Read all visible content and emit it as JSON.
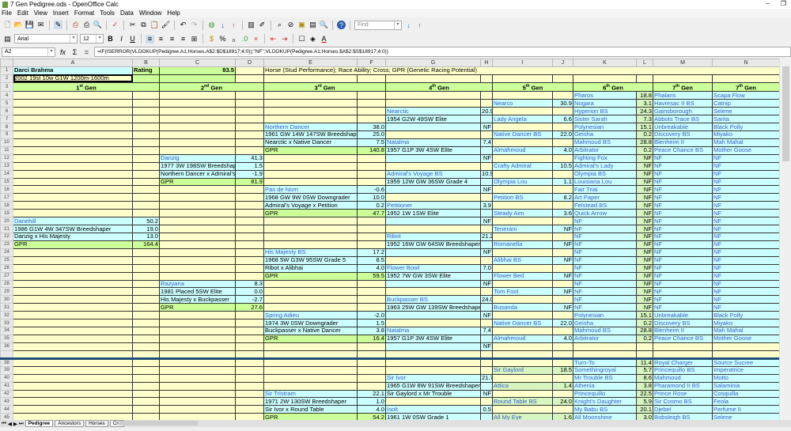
{
  "window": {
    "title": "7 Gen Pedigree.ods - OpenOffice Calc",
    "min": "–",
    "restore": "❐"
  },
  "menu": [
    "File",
    "Edit",
    "View",
    "Insert",
    "Format",
    "Tools",
    "Data",
    "Window",
    "Help"
  ],
  "toolbar": {
    "find_placeholder": "Find",
    "font_name": "Arial",
    "font_size": "12"
  },
  "formula_bar": {
    "cell_ref": "A2",
    "fx": "fx",
    "sum": "Σ",
    "eq": "=",
    "formula": "=IF(ISERROR(VLOOKUP(Pedigree.A1;Horses.A$2:$D$18917;4;0));\"NF\";VLOOKUP(Pedigree.A1;Horses.$A$2:$S$18917;4;0))"
  },
  "columns": [
    "A",
    "B",
    "C",
    "D",
    "E",
    "F",
    "G",
    "H",
    "I",
    "J",
    "K",
    "L",
    "M",
    "N"
  ],
  "header_rows": {
    "r1": {
      "A": "Darci Brahma",
      "B": "Rating",
      "C": "83.5",
      "E": "Horse (Stud Performance); Race Ability; Cross; GPR (Genetic Racing Potential)"
    },
    "r2": {
      "A": "2002 19st 10w G1W 1200m-1600m"
    },
    "gens": [
      {
        "n": "1",
        "sup": "st",
        "label": " Gen"
      },
      {
        "n": "2",
        "sup": "nd",
        "label": " Gen"
      },
      {
        "n": "3",
        "sup": "rd",
        "label": " Gen"
      },
      {
        "n": "4",
        "sup": "th",
        "label": " Gen"
      },
      {
        "n": "5",
        "sup": "th",
        "label": " Gen"
      },
      {
        "n": "6",
        "sup": "th",
        "label": " Gen"
      },
      {
        "n": "7",
        "sup": "th",
        "label": " Gen"
      },
      {
        "n": "7",
        "sup": "th",
        "label": " Gen"
      }
    ]
  },
  "rows": [
    {
      "n": 4,
      "K": "Pharos",
      "L": "18.8",
      "M": "Phalaris",
      "N": "Scapa Flow"
    },
    {
      "n": 5,
      "I": "Nearco",
      "J": "30.9",
      "K": "Nogara",
      "L": "3.1",
      "M": "Havresac II BS",
      "N": "Catnip"
    },
    {
      "n": 6,
      "G": "Nearctic",
      "H": "20.9",
      "K": "Hyperion BS",
      "L": "24.3",
      "M": "Gainsborough",
      "N": "Selene"
    },
    {
      "n": 7,
      "G": "1954 G2W 49SW Elite",
      "I": "Lady Angela",
      "J": "6.6",
      "K": "Sister Sarah",
      "L": "7.3",
      "M": "Abbots Trace BS",
      "N": "Sarita"
    },
    {
      "n": 8,
      "E": "Northern Dancer",
      "F": "38.0",
      "H": "NF",
      "K": "Polynesian",
      "L": "15.1",
      "M": "Unbreakable",
      "N": "Black Polly"
    },
    {
      "n": 9,
      "E": "1961 GW 14W 147SW Breedshaper",
      "F": "25.0",
      "I": "Native Dancer BS",
      "J": "22.0",
      "K": "Geisha",
      "L": "0.2",
      "M": "Discovery BS",
      "N": "Miyako"
    },
    {
      "n": 10,
      "E": "Nearctic x Native Dancer",
      "F": "7.5",
      "G": "Natalma",
      "H": "7.4",
      "K": "Mahmoud BS",
      "L": "28.8",
      "M": "Blenheim II",
      "N": "Mah Mahal"
    },
    {
      "n": 11,
      "E": "GPR",
      "F": "140.8",
      "G": "1957 G1P 3W 4SW Elite",
      "I": "Almahmoud",
      "J": "4.0",
      "K": "Arbitrator",
      "L": "0.2",
      "M": "Peace Chance BS",
      "N": "Mother Goose"
    },
    {
      "n": 12,
      "C": "Danzig",
      "D": "41.3",
      "H": "NF",
      "K": "Fighting Fox",
      "L": "NF",
      "M": "NF",
      "N": "NF"
    },
    {
      "n": 13,
      "C": "1977 3W 198SW Breedshaper",
      "D": "1.5",
      "I": "Crafty Admiral",
      "J": "10.5",
      "K": "Admiral's Lady",
      "L": "NF",
      "M": "NF",
      "N": "NF"
    },
    {
      "n": 14,
      "C": "Northern Dancer x Admiral's Voyage",
      "D": "-1.9",
      "G": "Admiral's Voyage BS",
      "H": "10.9",
      "K": "Olympia BS",
      "L": "NF",
      "M": "NF",
      "N": "NF"
    },
    {
      "n": 15,
      "C": "GPR",
      "D": "81.9",
      "G": "1959 12W GW 36SW Grade 4",
      "I": "Olympia Lou",
      "J": "1.1",
      "K": "Louisiana Lou",
      "L": "NF",
      "M": "NF",
      "N": "NF"
    },
    {
      "n": 16,
      "E": "Pas de Nom",
      "F": "-0.6",
      "H": "NF",
      "K": "Fair Trial",
      "L": "NF",
      "M": "NF",
      "N": "NF"
    },
    {
      "n": 17,
      "E": "1968 GW 9W 0SW Downgrader",
      "F": "10.0",
      "I": "Petition BS",
      "J": "8.2",
      "K": "Art Paper",
      "L": "NF",
      "M": "NF",
      "N": "NF"
    },
    {
      "n": 18,
      "E": "Admiral's Voyage x Petition",
      "F": "0.2",
      "G": "Petitioner",
      "H": "3.9",
      "K": "Felstead BS",
      "L": "NF",
      "M": "NF",
      "N": "NF"
    },
    {
      "n": 19,
      "E": "GPR",
      "F": "47.7",
      "G": "1952 1W 1SW Elite",
      "I": "Steady Aim",
      "J": "3.6",
      "K": "Quick Arrow",
      "L": "NF",
      "M": "NF",
      "N": "NF"
    },
    {
      "n": 20,
      "A": "Danehill",
      "B": "50.2",
      "H": "NF",
      "K": "NF",
      "L": "NF",
      "M": "NF",
      "N": "NF"
    },
    {
      "n": 21,
      "A": "1986 G1W 4W 347SW Breedshaper",
      "B": "19.0",
      "I": "Tenerani",
      "J": "NF",
      "K": "NF",
      "L": "NF",
      "M": "NF",
      "N": "NF"
    },
    {
      "n": 22,
      "A": "Danzig x His Majesty",
      "B": "13.0",
      "G": "Ribot",
      "H": "21.2",
      "K": "NF",
      "L": "NF",
      "M": "NF",
      "N": "NF"
    },
    {
      "n": 23,
      "A": "GPR",
      "B": "164.4",
      "G": "1952 16W GW 64SW Breedshaper",
      "I": "Romanella",
      "J": "NF",
      "K": "NF",
      "L": "NF",
      "M": "NF",
      "N": "NF"
    },
    {
      "n": 24,
      "E": "His Majesty BS",
      "F": "17.2",
      "H": "NF",
      "K": "NF",
      "L": "NF",
      "M": "NF",
      "N": "NF"
    },
    {
      "n": 25,
      "E": "1968 5W G3W 95SW Grade 5",
      "F": "8.5",
      "I": "Alibhai BS",
      "J": "NF",
      "K": "NF",
      "L": "NF",
      "M": "NF",
      "N": "NF"
    },
    {
      "n": 26,
      "E": "Ribot x Alibhai",
      "F": "4.0",
      "G": "Flower Bowl",
      "H": "7.0",
      "K": "NF",
      "L": "NF",
      "M": "NF",
      "N": "NF"
    },
    {
      "n": 27,
      "E": "GPR",
      "F": "59.5",
      "G": "1952 7W GW 3SW Elite",
      "I": "Flower Bed",
      "J": "NF",
      "K": "NF",
      "L": "NF",
      "M": "NF",
      "N": "NF"
    },
    {
      "n": 28,
      "C": "Razyana",
      "D": "8.3",
      "H": "NF",
      "K": "NF",
      "L": "NF",
      "M": "NF",
      "N": "NF"
    },
    {
      "n": 29,
      "C": "1981 Placed 5SW Elite",
      "D": "0.0",
      "I": "Tom Fool",
      "J": "NF",
      "K": "NF",
      "L": "NF",
      "M": "NF",
      "N": "NF"
    },
    {
      "n": 30,
      "C": "His Majesty x Buckpasser",
      "D": "-2.7",
      "G": "Buckpasser BS",
      "H": "24.0",
      "K": "NF",
      "L": "NF",
      "M": "NF",
      "N": "NF"
    },
    {
      "n": 31,
      "C": "GPR",
      "D": "27.6",
      "G": "1963 25W GW 139SW Breedshaper",
      "I": "Busanda",
      "J": "NF",
      "K": "NF",
      "L": "NF",
      "M": "NF",
      "N": "NF"
    },
    {
      "n": 32,
      "E": "Spring Adieu",
      "F": "-2.0",
      "H": "NF",
      "K": "Polynesian",
      "L": "15.1",
      "M": "Unbreakable",
      "N": "Black Polly"
    },
    {
      "n": 33,
      "E": "1974 3W 0SW Downgrader",
      "F": "1.5",
      "I": "Native Dancer BS",
      "J": "22.0",
      "K": "Geisha",
      "L": "0.2",
      "M": "Discovery BS",
      "N": "Miyako"
    },
    {
      "n": 34,
      "E": "Buckpasser x Native Dancer",
      "F": "3.8",
      "G": "Natalma",
      "H": "7.4",
      "K": "Mahmoud BS",
      "L": "28.8",
      "M": "Blenheim II",
      "N": "Mah Mahal"
    },
    {
      "n": 35,
      "E": "GPR",
      "F": "16.4",
      "G": "1957 G1P 3W 4SW Elite",
      "I": "Almahmoud",
      "J": "4.0",
      "K": "Arbitrator",
      "L": "0.2",
      "M": "Peace Chance BS",
      "N": "Mother Goose"
    },
    {
      "n": 36,
      "H": "NF"
    },
    {
      "n": 37
    },
    {
      "n": 38,
      "K": "Turn-To",
      "L": "11.4",
      "M": "Royal Charger",
      "N": "Source Sucree"
    },
    {
      "n": 39,
      "I": "Sir Gaylord",
      "J": "18.5",
      "K": "Somethingroyal",
      "L": "5.7",
      "M": "Princequillo BS",
      "N": "Imperatrice"
    },
    {
      "n": 40,
      "G": "Sir Ivor",
      "H": "21.7",
      "K": "Mr Trouble BS",
      "L": "8.6",
      "M": "Mahmoud",
      "N": "Motto"
    },
    {
      "n": 41,
      "G": "1965 G1W 8W 91SW Breedshaper",
      "I": "Attica",
      "J": "1.4",
      "K": "Athenia",
      "L": "3.8",
      "M": "Pharamond II BS",
      "N": "Salaminia"
    },
    {
      "n": 42,
      "E": "Sir Tristram",
      "F": "22.1",
      "G": "Sir Gaylord x Mr Trouble",
      "H": "NF",
      "K": "Princequillo",
      "L": "22.5",
      "M": "Prince Rose",
      "N": "Cosquilla"
    },
    {
      "n": 43,
      "E": "1971 2W 130SW Breedshaper",
      "F": "1.0",
      "I": "Round Table BS",
      "J": "24.0",
      "K": "Knight's Daughter",
      "L": "5.9",
      "M": "Sir Cosmo BS",
      "N": "Feola"
    },
    {
      "n": 44,
      "E": "Sir Ivor x Round Table",
      "F": "4.0",
      "G": "Isolt",
      "H": "0.5",
      "K": "My Babu BS",
      "L": "20.1",
      "M": "Djebel",
      "N": "Perfume II"
    },
    {
      "n": 45,
      "E": "GPR",
      "F": "54.2",
      "G": "1961 1W 0SW Grade 1",
      "I": "All My Eye",
      "J": "1.6",
      "K": "All Moonshine",
      "L": "3.0",
      "M": "Bobsleigh BS",
      "N": "Selene"
    }
  ],
  "sheet_tabs": [
    "Pedigree",
    "Ancestors",
    "Horses",
    "Cro"
  ],
  "active_tab": "Pedigree"
}
